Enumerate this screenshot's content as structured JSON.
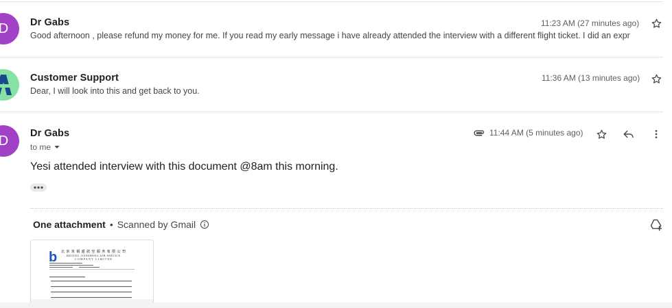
{
  "messages": [
    {
      "sender": "Dr Gabs",
      "avatar_letter": "D",
      "avatar_color": "#a142c6",
      "time": "11:23 AM (27 minutes ago)",
      "snippet": "Good afternoon , please refund my money for me. If you read my early message i have already attended the interview with a different flight ticket. I did an expr"
    },
    {
      "sender": "Customer Support",
      "avatar_color": "#86e3a4",
      "logo_color": "#1a4a8c",
      "time": "11:36 AM (13 minutes ago)",
      "snippet": "Dear, I will look into this and get back to you."
    },
    {
      "sender": "Dr Gabs",
      "avatar_letter": "D",
      "avatar_color": "#a142c6",
      "time": "11:44 AM (5 minutes ago)",
      "recipient_label": "to me",
      "body": "Yesi attended interview with this document @8am this morning.",
      "attachment_header": "One attachment",
      "scan_label": "Scanned by Gmail",
      "icons": [
        "paperclip-icon",
        "star-icon",
        "reply-icon",
        "more-vert-icon",
        "info-icon",
        "add-to-drive-icon",
        "chevron-down-icon"
      ]
    }
  ],
  "attachment_thumbnail": {
    "company_cn": "北 京 京 钢 盛 航 空 服 务 有 限 公 司",
    "company_en_1": "BEIJING JIANSHENG AIR SERVICE",
    "company_en_2": "COMPANY LIMITED",
    "logo_letter": "b",
    "logo_color": "#1a55c4"
  }
}
